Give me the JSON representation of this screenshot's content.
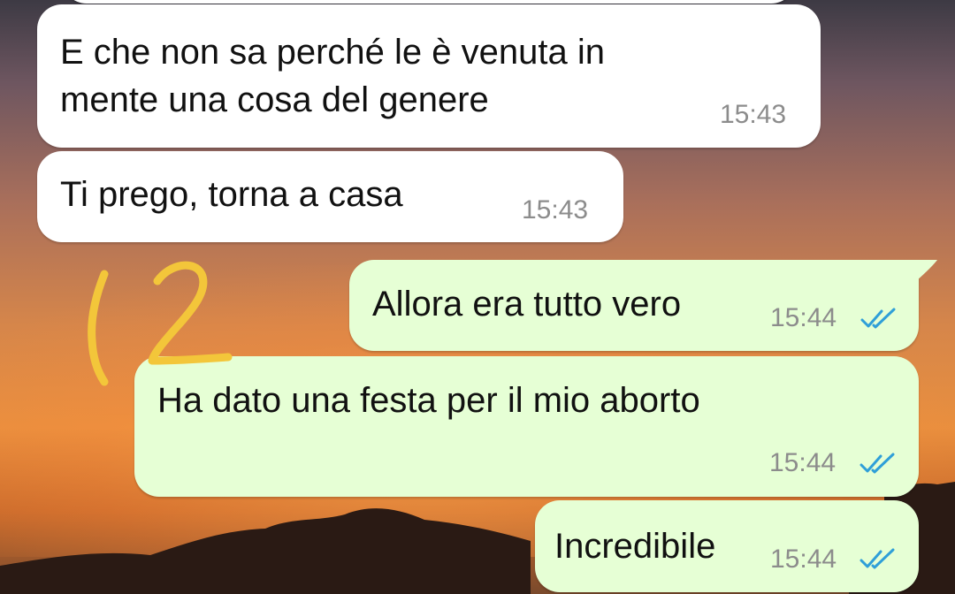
{
  "messages": [
    {
      "direction": "in",
      "line1": "E che non sa perché le è venuta in",
      "line2": "mente una cosa del genere",
      "time": "15:43"
    },
    {
      "direction": "in",
      "text": "Ti prego, torna a casa",
      "time": "15:43"
    },
    {
      "direction": "out",
      "text": "Allora era tutto vero",
      "time": "15:44",
      "status": "read"
    },
    {
      "direction": "out",
      "text": "Ha dato una festa per il mio aborto",
      "time": "15:44",
      "status": "read"
    },
    {
      "direction": "out",
      "text": "Incredibile",
      "time": "15:44",
      "status": "read"
    }
  ],
  "annotation": {
    "icon": "handwritten-12-mark",
    "color": "#f3c63a"
  },
  "colors": {
    "incoming_bubble": "#ffffff",
    "outgoing_bubble": "#e6ffd5",
    "read_tick": "#2f9fd8",
    "time_text": "#8c8c8c"
  }
}
